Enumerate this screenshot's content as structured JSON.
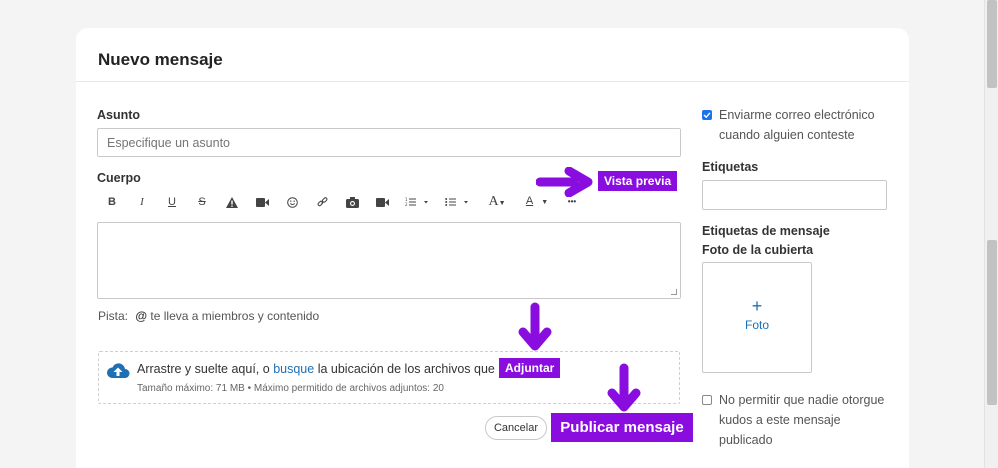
{
  "dialog": {
    "title": "Nuevo mensaje"
  },
  "subject": {
    "label": "Asunto",
    "placeholder": "Especifique un asunto"
  },
  "body": {
    "label": "Cuerpo",
    "preview_label": "Vista previa",
    "toolbar": {
      "bold": "B",
      "italic": "I",
      "underline": "U",
      "strike": "S",
      "font_size": "A",
      "text_color": "A",
      "more": "•••"
    }
  },
  "hint": {
    "prefix": "Pista:",
    "at": "@",
    "text": "te lleva a miembros y contenido"
  },
  "attachments": {
    "text_before": "Arrastre y suelte aquí, o",
    "link": "busque",
    "text_after": "la ubicación de los archivos que",
    "attach_label": "Adjuntar",
    "limits": "Tamaño máximo: 71 MB • Máximo permitido de archivos adjuntos: 20"
  },
  "actions": {
    "cancel": "Cancelar",
    "publish": "Publicar mensaje"
  },
  "sidebar": {
    "email_me_line1": "Enviarme correo electrónico",
    "email_me_line2": "cuando alguien conteste",
    "email_me_checked": true,
    "tags_label": "Etiquetas",
    "message_tags_label": "Etiquetas de mensaje",
    "cover_label": "Foto de la cubierta",
    "photo_plus": "+",
    "photo_label": "Foto",
    "no_kudos_line1": "No permitir que nadie otorgue",
    "no_kudos_line2": "kudos a este mensaje",
    "no_kudos_line3": "publicado",
    "no_kudos_checked": false
  },
  "colors": {
    "accent_purple": "#8a0de0",
    "link_blue": "#1f6fb5",
    "check_blue": "#1a73e8"
  }
}
